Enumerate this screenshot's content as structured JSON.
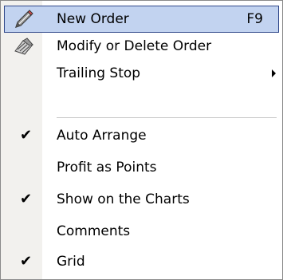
{
  "menu": {
    "items": [
      {
        "label": "New Order",
        "shortcut": "F9",
        "icon": "new-order-pencil-icon"
      },
      {
        "label": "Modify or Delete Order",
        "icon": "modify-order-icon"
      },
      {
        "label": "Trailing Stop",
        "submenu": true
      },
      {
        "label": "Auto Arrange",
        "checked": true
      },
      {
        "label": "Profit as Points",
        "checked": false
      },
      {
        "label": "Show on the Charts",
        "checked": true
      },
      {
        "label": "Comments",
        "checked": false
      },
      {
        "label": "Grid",
        "checked": true
      }
    ],
    "check_glyph": "✔",
    "colors": {
      "highlight_fill": "#c2d3f0",
      "highlight_border": "#30488a",
      "gutter": "#f2f1ee"
    }
  }
}
